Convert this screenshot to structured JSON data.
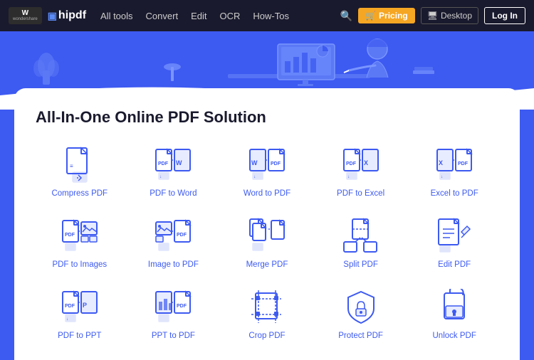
{
  "navbar": {
    "logo_ws": "W",
    "logo_ws_sub": "wondershare",
    "logo_hipdf": "hipdf",
    "nav_links": [
      {
        "label": "All tools",
        "id": "all-tools"
      },
      {
        "label": "Convert",
        "id": "convert"
      },
      {
        "label": "Edit",
        "id": "edit"
      },
      {
        "label": "OCR",
        "id": "ocr"
      },
      {
        "label": "How-Tos",
        "id": "how-tos"
      }
    ],
    "pricing_label": "Pricing",
    "desktop_label": "Desktop",
    "login_label": "Log In"
  },
  "hero": {
    "title": "All-In-One Online PDF Solution"
  },
  "tools": [
    {
      "label": "Compress PDF",
      "id": "compress-pdf",
      "icon": "compress"
    },
    {
      "label": "PDF to Word",
      "id": "pdf-to-word",
      "icon": "pdf-word"
    },
    {
      "label": "Word to PDF",
      "id": "word-to-pdf",
      "icon": "word-pdf"
    },
    {
      "label": "PDF to Excel",
      "id": "pdf-to-excel",
      "icon": "pdf-excel"
    },
    {
      "label": "Excel to PDF",
      "id": "excel-to-pdf",
      "icon": "excel-pdf"
    },
    {
      "label": "PDF to Images",
      "id": "pdf-to-images",
      "icon": "pdf-images"
    },
    {
      "label": "Image to PDF",
      "id": "image-to-pdf",
      "icon": "image-pdf"
    },
    {
      "label": "Merge PDF",
      "id": "merge-pdf",
      "icon": "merge"
    },
    {
      "label": "Split PDF",
      "id": "split-pdf",
      "icon": "split"
    },
    {
      "label": "Edit PDF",
      "id": "edit-pdf",
      "icon": "edit"
    },
    {
      "label": "PDF to PPT",
      "id": "pdf-to-ppt",
      "icon": "pdf-ppt"
    },
    {
      "label": "PPT to PDF",
      "id": "ppt-to-pdf",
      "icon": "ppt-pdf"
    },
    {
      "label": "Crop PDF",
      "id": "crop-pdf",
      "icon": "crop"
    },
    {
      "label": "Protect PDF",
      "id": "protect-pdf",
      "icon": "protect"
    },
    {
      "label": "Unlock PDF",
      "id": "unlock-pdf",
      "icon": "unlock"
    }
  ],
  "colors": {
    "accent": "#3d5af1",
    "nav_bg": "#1a1a2e",
    "hero_bg": "#3d5af1",
    "pricing_btn": "#f5a623"
  }
}
